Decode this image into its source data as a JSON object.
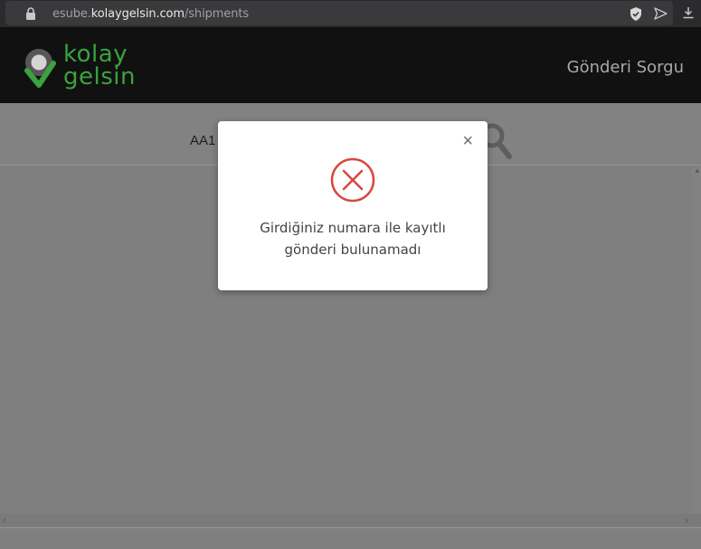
{
  "browser": {
    "url_prefix": "esube.",
    "url_domain": "kolaygelsin.com",
    "url_path": "/shipments"
  },
  "header": {
    "logo_line1": "kolay",
    "logo_line2": "gelsin",
    "nav_title": "Gönderi Sorgu",
    "brand_color": "#3aa23f"
  },
  "search": {
    "value": "AA1"
  },
  "modal": {
    "close_label": "×",
    "message_line1": "Girdiğiniz numara ile kayıtlı",
    "message_line2": "gönderi bulunamadı",
    "icon": "error-x-circle-icon",
    "icon_color": "#d9473b"
  },
  "scroll": {
    "up_arrow": "▲",
    "left_arrow": "‹",
    "right_arrow": "›"
  }
}
